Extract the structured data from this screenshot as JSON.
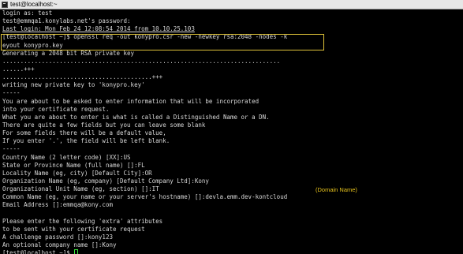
{
  "window": {
    "title": "test@localhost:~",
    "icon": "terminal-icon"
  },
  "terminal": {
    "lines": [
      "login as: test",
      "test@emmqa1.konylabs.net's password:",
      "Last login: Mon Feb 24 12:08:54 2014 from 10.10.25.103",
      "[test@localhost ~]$ openssl req -out konypro.csr -new -newkey rsa:2048 -nodes -k",
      "eyout konypro.key",
      "Generating a 2048 bit RSA private key",
      "..............................................................................",
      "......+++",
      "..........................................+++",
      "writing new private key to 'konypro.key'",
      "-----",
      "You are about to be asked to enter information that will be incorporated",
      "into your certificate request.",
      "What you are about to enter is what is called a Distinguished Name or a DN.",
      "There are quite a few fields but you can leave some blank",
      "For some fields there will be a default value,",
      "If you enter '.', the field will be left blank.",
      "-----",
      "Country Name (2 letter code) [XX]:US",
      "State or Province Name (full name) []:FL",
      "Locality Name (eg, city) [Default City]:OR",
      "Organization Name (eg, company) [Default Company Ltd]:Kony",
      "Organizational Unit Name (eg, section) []:IT",
      "Common Name (eg, your name or your server's hostname) []:devla.emm.dev-kontcloud",
      "Email Address []:emmqa@kony.com",
      "",
      "Please enter the following 'extra' attributes",
      "to be sent with your certificate request",
      "A challenge password []:kony123",
      "An optional company name []:Kony",
      "[test@localhost ~]$ "
    ],
    "cursor_color": "#3ce63c",
    "text_color": "#d8d8d8",
    "background_color": "#000000"
  },
  "annotations": {
    "domain_name_label": "(Domain Name)",
    "label_color": "#e6c21c",
    "highlight_box_color": "#e0c43a"
  }
}
